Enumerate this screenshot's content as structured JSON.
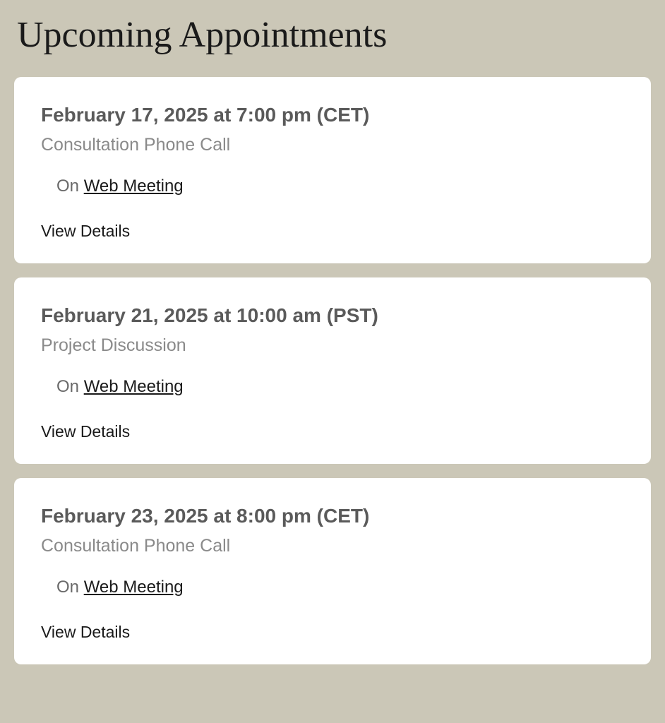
{
  "header": {
    "title": "Upcoming Appointments"
  },
  "appointments": [
    {
      "datetime": "February 17, 2025 at 7:00 pm (CET)",
      "type": "Consultation Phone Call",
      "location_prefix": "On ",
      "location_link": "Web Meeting",
      "view_details_label": "View Details"
    },
    {
      "datetime": "February 21, 2025 at 10:00 am (PST)",
      "type": "Project Discussion",
      "location_prefix": "On ",
      "location_link": "Web Meeting",
      "view_details_label": "View Details"
    },
    {
      "datetime": "February 23, 2025 at 8:00 pm (CET)",
      "type": "Consultation Phone Call",
      "location_prefix": "On ",
      "location_link": "Web Meeting",
      "view_details_label": "View Details"
    }
  ]
}
